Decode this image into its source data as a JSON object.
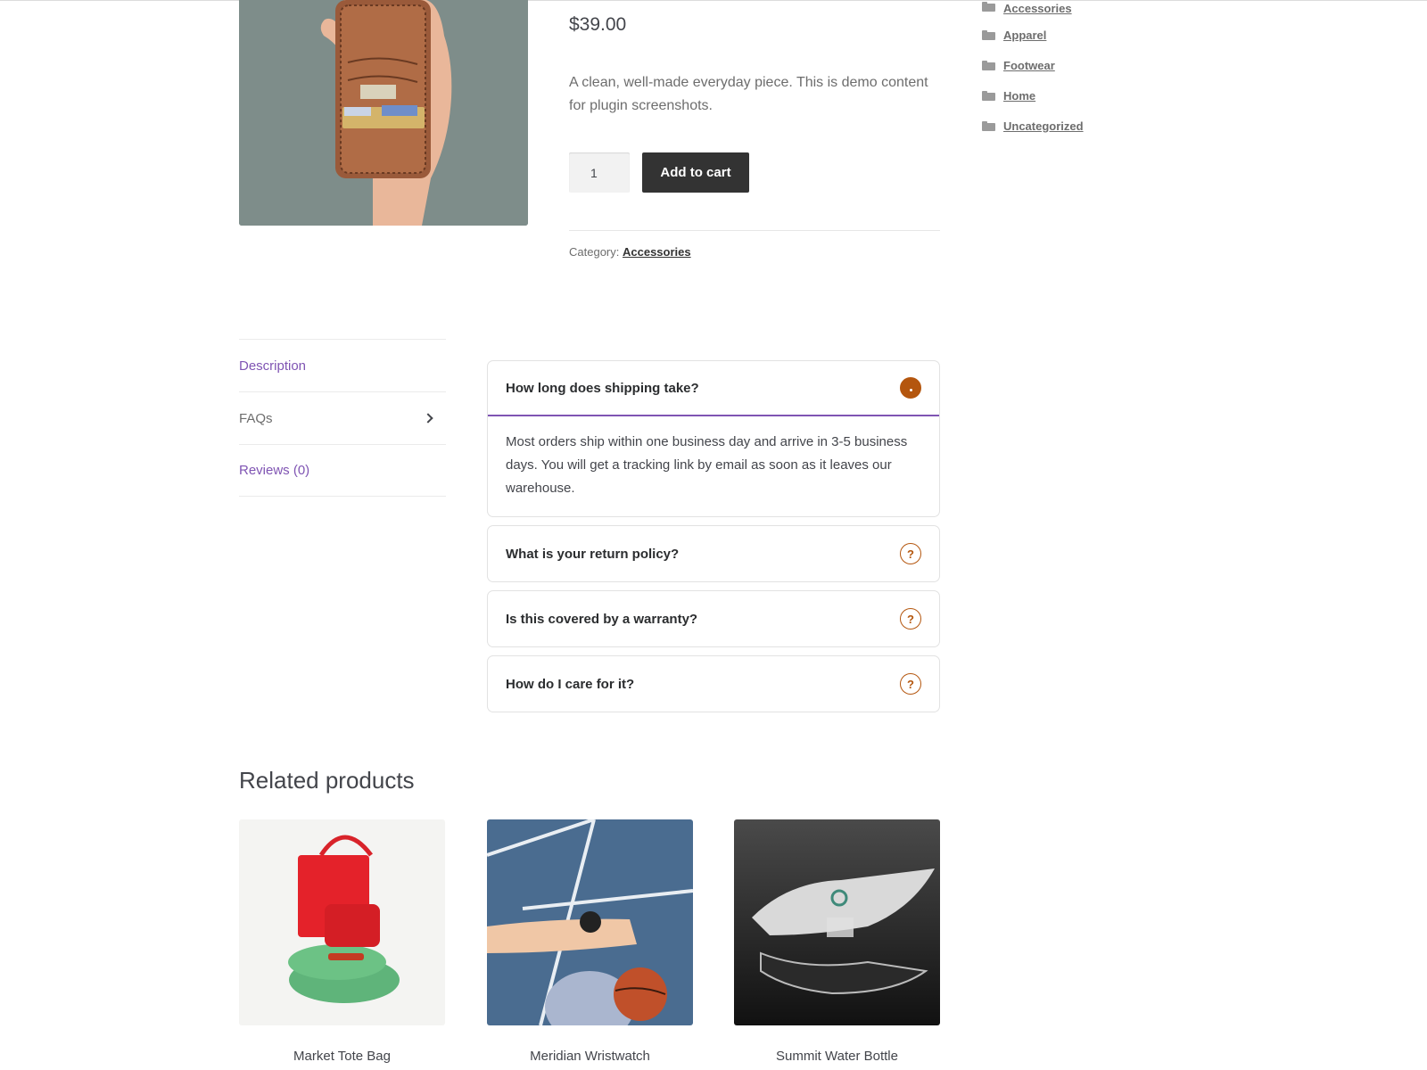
{
  "product": {
    "image_alt": "Leather wallet held in hand",
    "price": "$39.00",
    "short_description": "A clean, well-made everyday piece. This is demo content for plugin screenshots.",
    "quantity": "1",
    "add_to_cart_label": "Add to cart",
    "category_prefix": "Category:",
    "category": "Accessories"
  },
  "sidebar": {
    "categories": [
      {
        "label": "Accessories",
        "icon": "folder-open-icon"
      },
      {
        "label": "Apparel",
        "icon": "folder-icon"
      },
      {
        "label": "Footwear",
        "icon": "folder-icon"
      },
      {
        "label": "Home",
        "icon": "folder-icon"
      },
      {
        "label": "Uncategorized",
        "icon": "folder-icon"
      }
    ]
  },
  "tabs": [
    {
      "label": "Description"
    },
    {
      "label": "FAQs",
      "active": true
    },
    {
      "label": "Reviews (0)"
    }
  ],
  "faq": {
    "items": [
      {
        "question": "How long does shipping take?",
        "answer": "Most orders ship within one business day and arrive in 3-5 business days. You will get a tracking link by email as soon as it leaves our warehouse.",
        "open": true
      },
      {
        "question": "What is your return policy?",
        "icon": "?"
      },
      {
        "question": "Is this covered by a warranty?",
        "icon": "?"
      },
      {
        "question": "How do I care for it?",
        "icon": "?"
      }
    ]
  },
  "related": {
    "title": "Related products",
    "items": [
      {
        "name": "Market Tote Bag"
      },
      {
        "name": "Meridian Wristwatch"
      },
      {
        "name": "Summit Water Bottle"
      }
    ]
  },
  "colors": {
    "accent_purple": "#7f54b3",
    "accent_orange": "#b4560e",
    "button_dark": "#333333"
  }
}
